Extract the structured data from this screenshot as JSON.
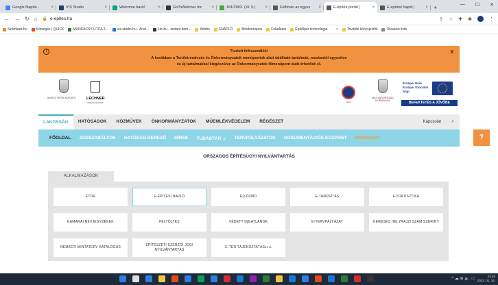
{
  "browser": {
    "tabs": [
      {
        "label": "Google Naptár -",
        "color": "#4285f4"
      },
      {
        "label": "VIS Studio",
        "color": "#2b3a67"
      },
      {
        "label": "Welcome back!",
        "color": "#0aa37f"
      },
      {
        "label": "GoToWebinar Inc",
        "color": "#333333"
      },
      {
        "label": "181/2003. (XI. 5.)",
        "color": "#44aa44"
      },
      {
        "label": "Felhívás az egyes",
        "color": "#555555"
      },
      {
        "label": "E-építés portál |",
        "color": "#555555",
        "active": true
      },
      {
        "label": "E-építési Napló |",
        "color": "#555555"
      }
    ],
    "new_tab": "+",
    "window_controls": {
      "minimize": "—",
      "maximize": "☐",
      "close": "✕"
    },
    "url": "e-epites.hu",
    "bookmarks": [
      {
        "label": "Számlázz.hu",
        "color": "#e88a2a"
      },
      {
        "label": "Kötvegek | QUICK",
        "color": "#e64a19"
      },
      {
        "label": "MUNKÁCSY UTCA 2...",
        "color": "#2e7d32"
      },
      {
        "label": "vis-studio.hu - Anal...",
        "color": "#1976d2"
      },
      {
        "label": "1to.hu - instant dom...",
        "color": "#333333"
      },
      {
        "label": "Adobe",
        "color": "#f5c542"
      },
      {
        "label": "ENAPLÓ",
        "color": "#f5c542"
      },
      {
        "label": "Mindennapos",
        "color": "#f5c542"
      },
      {
        "label": "Feladatok",
        "color": "#f5c542"
      },
      {
        "label": "Építőipar technológia",
        "color": "#f5c542"
      },
      {
        "label": "»",
        "color": "#ffffff"
      },
      {
        "label": "További könyvjelzők",
        "color": "#f5c542"
      },
      {
        "label": "Olvasási lista",
        "color": "#888888"
      }
    ]
  },
  "banner": {
    "line1": "Tisztelt felhasználók!",
    "line2": "A korábban a Területrendezés és Önkormányzatok menüpontok alatt található tartalmak, mostantól egyesítve",
    "line3": "és új tartalmakkal kiegészülve az Önkormányzatok főmenüpont alatt érhetőek el.",
    "close": "X",
    "icon": "exclamation-icon"
  },
  "header": {
    "ministry_label": "Miniszterelnökség",
    "lechner_title": "LECHNER",
    "lechner_subtitle": "TUDÁSKÖZPONT",
    "badge_label": "2020",
    "gov_label": "Magyarország Kormánya",
    "eu_text_1": "Európai Unió",
    "eu_text_2": "Európai Szociális",
    "eu_text_3": "Alap",
    "invest_button": "BEFEKTETÉS A JÖVŐBE"
  },
  "main_nav": {
    "items": [
      "LAKOSSÁG",
      "HATÓSÁGOK",
      "KÖZMŰVEK",
      "ÖNKORMÁNYZATOK",
      "MŰEMLÉKVÉDELEM",
      "RÉGÉSZET"
    ],
    "contact": "Kapcsolat",
    "search_icon": "magnifier-icon"
  },
  "sub_nav": {
    "items": [
      "FŐOLDAL",
      "JOGSZABÁLYOK",
      "HATÓSÁG KERESŐ",
      "HÍREK",
      "TUDÁSTÁR ⌄",
      "TERVPÁLYÁZATOK",
      "DOKUMENTÁCIÓS KÖZPONT",
      "OPENDATA"
    ],
    "help": "?"
  },
  "content": {
    "title": "ORSZÁGOS ÉPÍTÉSÜGYI NYILVÁNTARTÁS",
    "apps_tab": "ALKALMAZÁSOK",
    "apps": [
      "ÉTDR",
      "E-ÉPÍTÉSI NAPLÓ",
      "E-KÖZMŰ",
      "E-TANÚSÍTÁS",
      "E-STATISZTIKA",
      "KAMARAI NÉVJEGYZÉKEK",
      "FELTÖLTÉS",
      "VÉDETT INGATLANOK",
      "E-TERVPÁLYÁZAT",
      "KERESÉS HELYRAJZI SZÁM SZERINT",
      "NEMZETI MINTATERV KATALÓGUS",
      "ÉPÍTÉSZETI SZERZŐI JOGI NYILVÁNTARTÁS",
      "E-TÉR TÁJÉKOZTATÁS"
    ],
    "beta_label": "BETA"
  },
  "taskbar": {
    "icons": [
      "#2f7de1",
      "#e0e0e0",
      "#2f7de1",
      "#f5c542",
      "#e64a19",
      "#2f7de1",
      "#0f9d58",
      "#2f7de1",
      "#d32f2f",
      "#1976d2",
      "#8e24aa",
      "#2e7d32",
      "#f5c542",
      "#1976d2",
      "#2f7de1",
      "#e64a19",
      "#1976d2",
      "#2e7d32",
      "#d32f2f",
      "#333333"
    ],
    "tray": "^ ☁ ⊕ 🔈 ▭",
    "time": "23:45",
    "date": "2022. 01. 16."
  }
}
